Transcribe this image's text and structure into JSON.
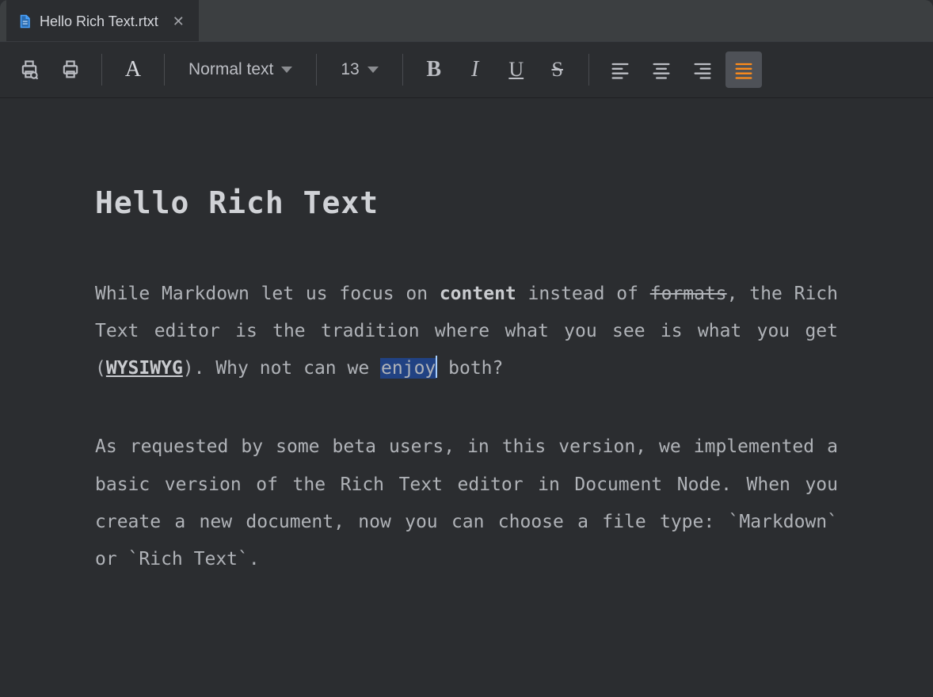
{
  "tab": {
    "title": "Hello Rich Text.rtxt"
  },
  "toolbar": {
    "style_label": "Normal text",
    "fontsize": "13"
  },
  "document": {
    "heading": "Hello Rich Text",
    "p1": {
      "t1": "While Markdown let us focus on ",
      "bold": "content",
      "t2": " instead of ",
      "strike": "formats",
      "t3": ", the Rich Text editor is the tradition where what you see is what you get (",
      "ub": "WYSIWYG",
      "t4": "). Why not can we ",
      "sel": "enjoy",
      "t5": " both?"
    },
    "p2": {
      "t1": "As requested by some beta users, in this version, we implemented a basic version of the Rich Text editor in Document Node. When you create a new document, now you can choose a file type: `",
      "code1": "Markdown",
      "t2": "` or `",
      "code2": "Rich Text",
      "t3": "`."
    }
  }
}
